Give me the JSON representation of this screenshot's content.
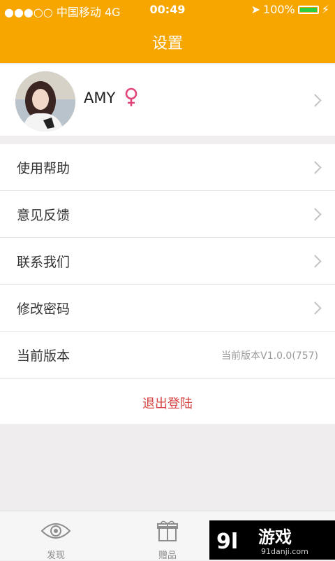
{
  "status_bar": {
    "carrier": "●●●○○ 中国移动  4G",
    "time": "00:49",
    "battery": "100%"
  },
  "header": {
    "title": "设置"
  },
  "profile": {
    "name": "AMY"
  },
  "menu": {
    "items": [
      {
        "label": "使用帮助"
      },
      {
        "label": "意见反馈"
      },
      {
        "label": "联系我们"
      },
      {
        "label": "修改密码"
      },
      {
        "label": "当前版本",
        "value": "当前版本V1.0.0(757)"
      }
    ]
  },
  "logout": {
    "label": "退出登陆"
  },
  "tabbar": {
    "tabs": [
      {
        "label": "发现",
        "icon": "eye-icon"
      },
      {
        "label": "赠品",
        "icon": "gift-icon"
      }
    ]
  },
  "watermark": {
    "brand": "游戏",
    "url": "91danji.com",
    "logo_text": "9l"
  },
  "colors": {
    "accent": "#f7a600",
    "logout": "#d64443",
    "female": "#e0457b"
  }
}
